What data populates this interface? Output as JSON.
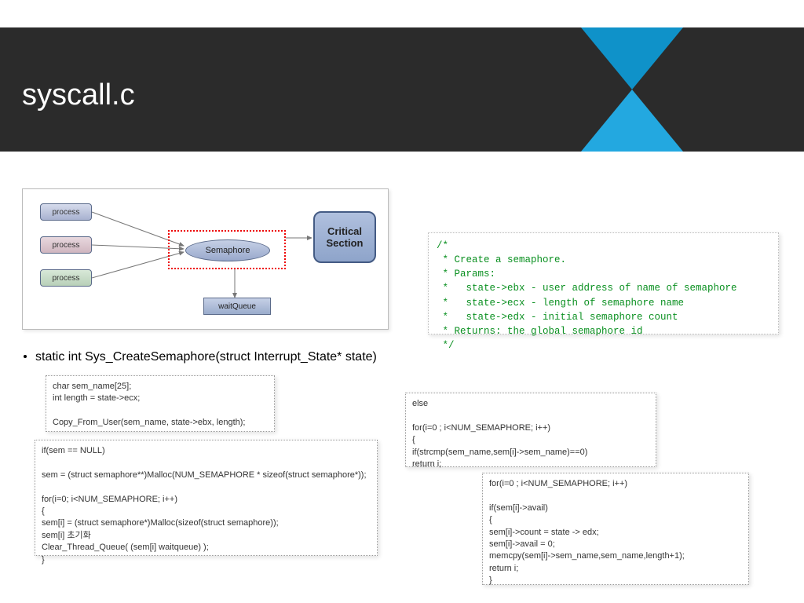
{
  "title": "syscall.c",
  "diagram": {
    "process": "process",
    "semaphore": "Semaphore",
    "critical1": "Critical",
    "critical2": "Section",
    "waitqueue": "waitQueue"
  },
  "bullet": "static int Sys_CreateSemaphore(struct Interrupt_State* state)",
  "code1": "char sem_name[25];\nint length = state->ecx;\n\nCopy_From_User(sem_name, state->ebx, length);",
  "code2": "if(sem == NULL)\n\nsem = (struct semaphore**)Malloc(NUM_SEMAPHORE * sizeof(struct semaphore*));\n\nfor(i=0; i<NUM_SEMAPHORE; i++)\n{\nsem[i] = (struct semaphore*)Malloc(sizeof(struct semaphore));\nsem[i] 초기화\nClear_Thread_Queue( (sem[i] waitqueue) );\n}",
  "code3": "else\n\nfor(i=0 ; i<NUM_SEMAPHORE; i++)\n{\nif(strcmp(sem_name,sem[i]->sem_name)==0)\nreturn i;",
  "code4": "for(i=0 ; i<NUM_SEMAPHORE; i++)\n\nif(sem[i]->avail)\n{\nsem[i]->count = state -> edx;\nsem[i]->avail = 0;\nmemcpy(sem[i]->sem_name,sem_name,length+1);\nreturn i;\n}",
  "green": "/*\n * Create a semaphore.\n * Params:\n *   state->ebx - user address of name of semaphore\n *   state->ecx - length of semaphore name\n *   state->edx - initial semaphore count\n * Returns: the global semaphore id\n */"
}
